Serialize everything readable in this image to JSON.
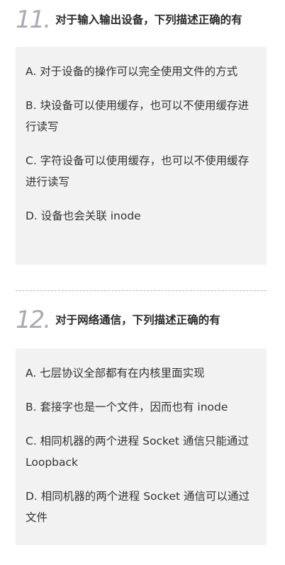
{
  "q11": {
    "number": "11.",
    "title": "对于输入输出设备，下列描述正确的有",
    "options": [
      "A. 对于设备的操作可以完全使用文件的方式",
      "B. 块设备可以使用缓存，也可以不使用缓存进行读写",
      "C.  字符设备可以使用缓存，也可以不使用缓存进行读写",
      "D. 设备也会关联 inode"
    ]
  },
  "q12": {
    "number": "12.",
    "title": "对于网络通信，下列描述正确的有",
    "options": [
      "A. 七层协议全部都有在内核里面实现",
      "B. 套接字也是一个文件，因而也有 inode",
      "C. 相同机器的两个进程 Socket 通信只能通过 Loopback",
      "D. 相同机器的两个进程 Socket 通信可以通过文件"
    ]
  }
}
